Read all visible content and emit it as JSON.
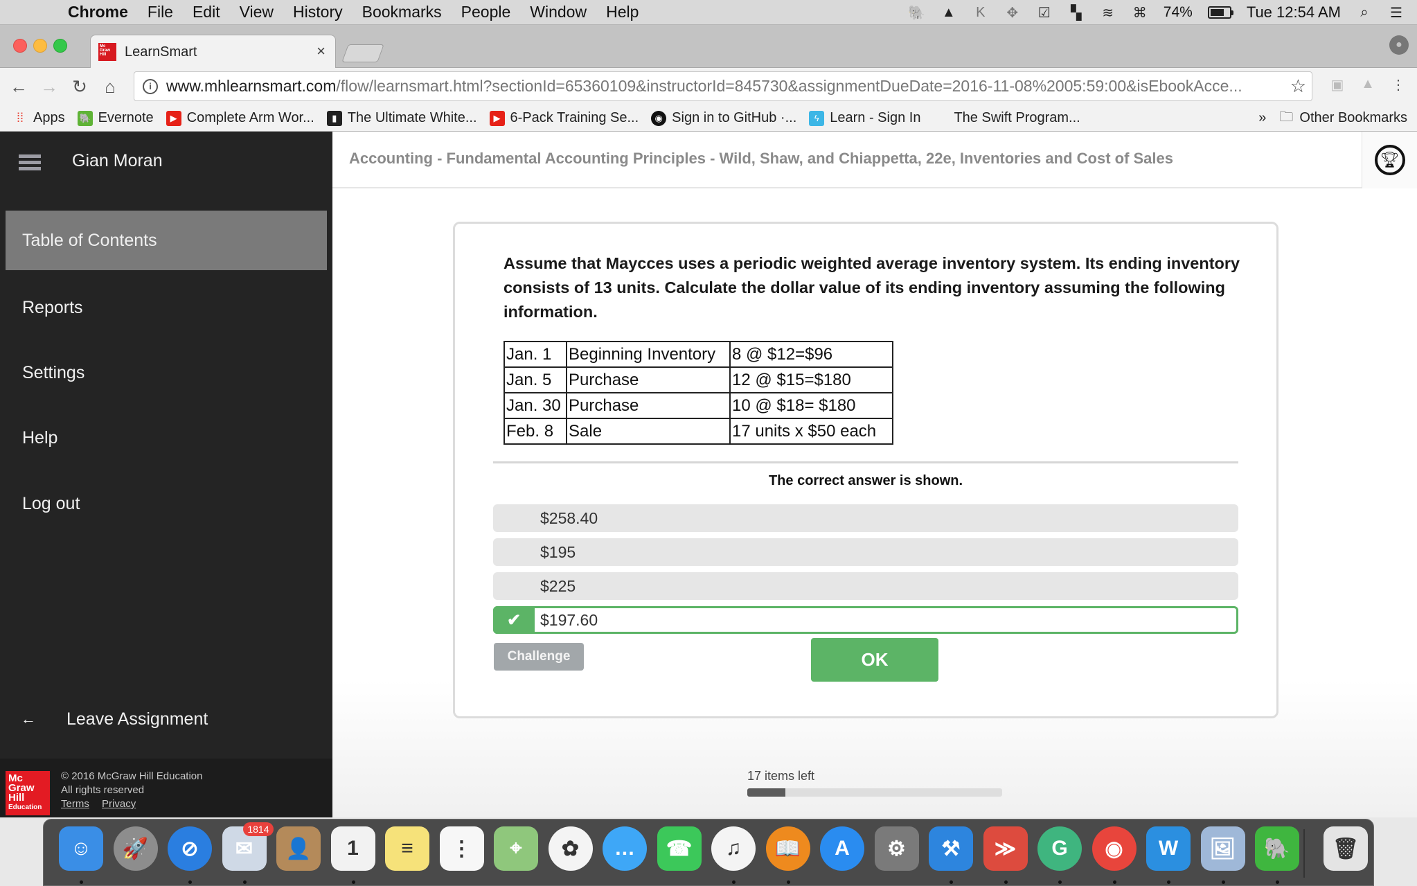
{
  "menubar": {
    "app_name": "Chrome",
    "items": [
      "File",
      "Edit",
      "View",
      "History",
      "Bookmarks",
      "People",
      "Window",
      "Help"
    ],
    "battery_percent": "74%",
    "battery_level": 0.74,
    "clock": "Tue 12:54 AM",
    "status_icons": [
      "evernote-icon",
      "google-drive-icon",
      "k-app-icon",
      "dropbox-icon",
      "todoist-icon",
      "window-layout-icon",
      "wifi-icon",
      "keyboard-icon"
    ]
  },
  "browser": {
    "tab_title": "LearnSmart",
    "tab_close": "×",
    "url_host": "www.mhlearnsmart.com",
    "url_path": "/flow/learnsmart.html?sectionId=65360109&instructorId=845730&assignmentDueDate=2016-11-08%2005:59:00&isEbookAcce...",
    "bookmarks": [
      {
        "label": "Apps",
        "icon": "apps-grid-icon",
        "color": "#4a8af4"
      },
      {
        "label": "Evernote",
        "icon": "evernote-icon",
        "color": "#5fb336"
      },
      {
        "label": "Complete Arm Wor...",
        "icon": "youtube-icon",
        "color": "#e62117"
      },
      {
        "label": "The Ultimate White...",
        "icon": "bars-icon",
        "color": "#222222"
      },
      {
        "label": "6-Pack Training Se...",
        "icon": "youtube-icon",
        "color": "#e62117"
      },
      {
        "label": "Sign in to GitHub ·...",
        "icon": "github-icon",
        "color": "#111111"
      },
      {
        "label": "Learn - Sign In",
        "icon": "bolt-icon",
        "color": "#3cb6e6"
      },
      {
        "label": "The Swift Program...",
        "icon": "apple-icon",
        "color": "#333333"
      }
    ],
    "bookmarks_overflow": "»",
    "other_bookmarks": "Other Bookmarks"
  },
  "sidebar": {
    "user_name": "Gian Moran",
    "items": [
      {
        "label": "Table of Contents",
        "active": true
      },
      {
        "label": "Reports",
        "active": false
      },
      {
        "label": "Settings",
        "active": false
      },
      {
        "label": "Help",
        "active": false
      },
      {
        "label": "Log out",
        "active": false
      }
    ],
    "leave_label": "Leave Assignment",
    "footer": {
      "logo_lines": [
        "Mc",
        "Graw",
        "Hill",
        "Education"
      ],
      "copyright": "© 2016 McGraw Hill Education",
      "rights": "All rights reserved",
      "terms": "Terms",
      "privacy": "Privacy"
    }
  },
  "header": {
    "course_title": "Accounting - Fundamental Accounting Principles - Wild, Shaw, and Chiappetta, 22e, Inventories and Cost of Sales"
  },
  "question": {
    "text": "Assume that Maycces uses a periodic weighted average inventory system. Its ending inventory consists of 13 units. Calculate the dollar value of its ending inventory assuming the following information.",
    "table": [
      [
        "Jan. 1",
        "Beginning Inventory",
        "8 @ $12=$96"
      ],
      [
        "Jan. 5",
        "Purchase",
        "12 @ $15=$180"
      ],
      [
        "Jan. 30",
        "Purchase",
        "10 @ $18= $180"
      ],
      [
        "Feb. 8",
        "Sale",
        "17 units x $50 each"
      ]
    ],
    "feedback": "The correct answer is shown.",
    "options": [
      {
        "label": "$258.40",
        "correct": false
      },
      {
        "label": "$195",
        "correct": false
      },
      {
        "label": "$225",
        "correct": false
      },
      {
        "label": "$197.60",
        "correct": true
      }
    ],
    "challenge_label": "Challenge",
    "ok_label": "OK"
  },
  "progress": {
    "label": "17 items left",
    "fraction_complete": 0.15
  },
  "dock": {
    "apps": [
      {
        "name": "finder",
        "color": "#3a8ee6",
        "glyph": "☺"
      },
      {
        "name": "launchpad",
        "color": "#8d8d8d",
        "glyph": "🚀"
      },
      {
        "name": "safari",
        "color": "#2a7ee0",
        "glyph": "⊘"
      },
      {
        "name": "mail",
        "color": "#cfd9e6",
        "glyph": "✉",
        "badge": "1814"
      },
      {
        "name": "contacts",
        "color": "#b48a5a",
        "glyph": "👤"
      },
      {
        "name": "calendar",
        "color": "#f2f2f2",
        "glyph": "1"
      },
      {
        "name": "notes",
        "color": "#f6e27a",
        "glyph": "≡"
      },
      {
        "name": "reminders",
        "color": "#f7f7f7",
        "glyph": "⋮"
      },
      {
        "name": "maps",
        "color": "#8fc77c",
        "glyph": "⌖"
      },
      {
        "name": "photos",
        "color": "#f4f4f4",
        "glyph": "✿"
      },
      {
        "name": "messages",
        "color": "#3ea7f7",
        "glyph": "…"
      },
      {
        "name": "facetime",
        "color": "#3cc85a",
        "glyph": "☎"
      },
      {
        "name": "itunes",
        "color": "#f4f4f4",
        "glyph": "♫"
      },
      {
        "name": "ibooks",
        "color": "#ee8a1e",
        "glyph": "📖"
      },
      {
        "name": "app-store",
        "color": "#2a8cf0",
        "glyph": "A"
      },
      {
        "name": "system-preferences",
        "color": "#7a7a7a",
        "glyph": "⚙"
      },
      {
        "name": "xcode",
        "color": "#2d85de",
        "glyph": "⚒"
      },
      {
        "name": "todoist",
        "color": "#dd4b3e",
        "glyph": "≫"
      },
      {
        "name": "grammarly",
        "color": "#3fb57f",
        "glyph": "G"
      },
      {
        "name": "chrome",
        "color": "#e8453c",
        "glyph": "◉"
      },
      {
        "name": "word",
        "color": "#2b8fe0",
        "glyph": "W"
      },
      {
        "name": "preview",
        "color": "#9fb8d8",
        "glyph": "🖼"
      },
      {
        "name": "evernote",
        "color": "#3fb63f",
        "glyph": "🐘"
      },
      {
        "name": "trash",
        "color": "#e4e4e4",
        "glyph": "🗑"
      }
    ]
  }
}
